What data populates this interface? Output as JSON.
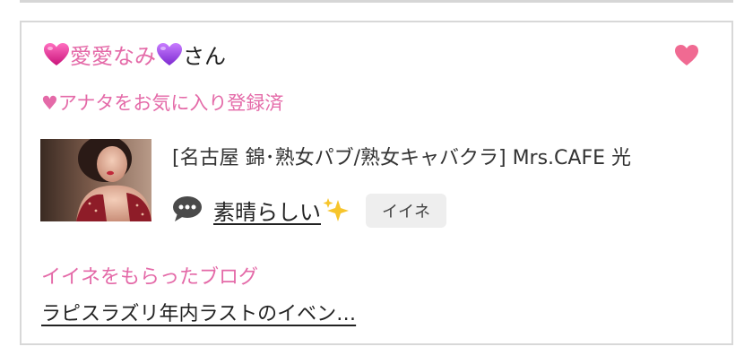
{
  "card": {
    "user_name": "愛愛なみ",
    "honorific": "さん",
    "favorite_status": "♥アナタをお気に入り登録済",
    "shop": "[名古屋 錦･熟女パブ/熟女キャバクラ]  Mrs.CAFE 光",
    "post_text": "素晴らしい",
    "iine_button": "イイネ",
    "blog_label": "イイネをもらったブログ",
    "blog_title": "ラピスラズリ年内ラストのイベン…"
  },
  "colors": {
    "accent_pink": "#e46aa8",
    "heart_pink": "#f06a92",
    "magenta_heart": "#e0308c",
    "purple_heart": "#a64ae6",
    "border": "#d8d8d8"
  },
  "icons": {
    "name_left": "magenta-heart-icon",
    "name_right": "purple-heart-icon",
    "favorite": "heart-icon",
    "post": "speech-bubble-icon",
    "sparkles": "sparkles-icon"
  }
}
